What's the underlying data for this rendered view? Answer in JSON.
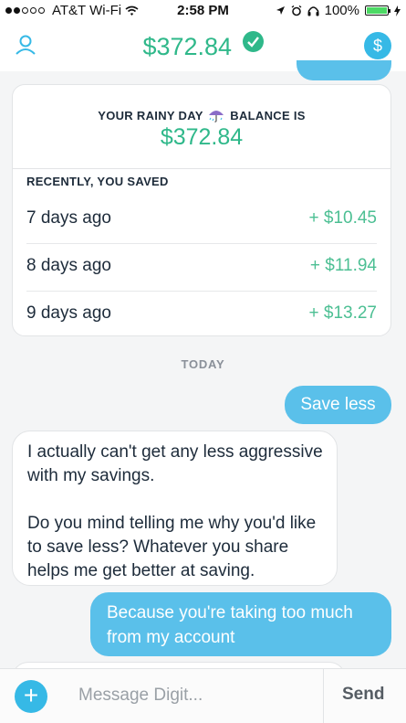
{
  "status_bar": {
    "carrier": "AT&T Wi-Fi",
    "time": "2:58 PM",
    "battery": "100%",
    "battery_level": 1.0
  },
  "header": {
    "balance": "$372.84",
    "profile_icon": "person-icon",
    "verified_icon": "check-icon",
    "dollar_button_label": "$"
  },
  "balance_card": {
    "label_before": "YOUR RAINY DAY",
    "label_after": "BALANCE IS",
    "amount": "$372.84",
    "recent_heading": "RECENTLY, YOU SAVED",
    "rows": [
      {
        "date": "7 days ago",
        "amount": "+ $10.45"
      },
      {
        "date": "8 days ago",
        "amount": "+ $11.94"
      },
      {
        "date": "9 days ago",
        "amount": "+ $13.27"
      }
    ]
  },
  "chat": {
    "day_separator": "TODAY",
    "messages": [
      {
        "from": "user",
        "text": "Save less"
      },
      {
        "from": "bot",
        "paragraphs": [
          "I actually can't get any less aggressive with my savings.",
          "Do you mind telling me why you'd like to save less? Whatever you share helps me get better at saving."
        ]
      },
      {
        "from": "user",
        "text": "Because you're taking too much from my account"
      }
    ]
  },
  "input_bar": {
    "add_label": "+",
    "placeholder": "Message Digit...",
    "send_label": "Send"
  },
  "colors": {
    "accent_green": "#2fb88a",
    "accent_blue": "#36b9e6",
    "user_bubble": "#5ac0ea"
  }
}
